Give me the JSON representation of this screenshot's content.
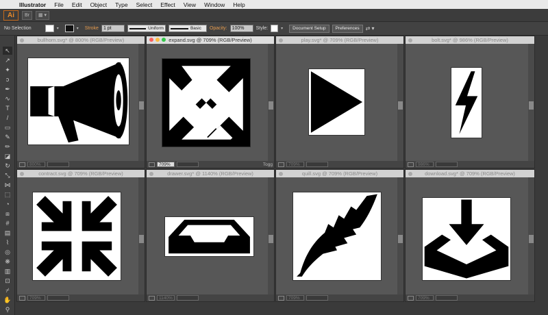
{
  "menubar": {
    "app_name": "Illustrator",
    "items": [
      "File",
      "Edit",
      "Object",
      "Type",
      "Select",
      "Effect",
      "View",
      "Window",
      "Help"
    ]
  },
  "appbar": {
    "logo_text": "Ai",
    "bridge_label": "Br"
  },
  "controlbar": {
    "selection_label": "No Selection",
    "stroke_label": "Stroke",
    "stroke_value": "1 pt",
    "profile_label": "Uniform",
    "brush_label": "Basic",
    "opacity_label": "Opacity:",
    "opacity_value": "100%",
    "style_label": "Style:",
    "document_setup_label": "Document Setup",
    "preferences_label": "Preferences"
  },
  "windows": [
    {
      "title": "bullhorn.svg* @ 800% (RGB/Preview)",
      "zoom": "800%",
      "icon": "bullhorn-icon",
      "active": false
    },
    {
      "title": "expand.svg @ 709% (RGB/Preview)",
      "zoom": "709%",
      "icon": "expand-icon",
      "active": true
    },
    {
      "title": "play.svg* @ 709% (RGB/Preview)",
      "zoom": "709%",
      "icon": "play-icon",
      "active": false
    },
    {
      "title": "bolt.svg* @ 986% (RGB/Preview)",
      "zoom": "986%",
      "icon": "bolt-icon",
      "active": false
    },
    {
      "title": "contract.svg @ 709% (RGB/Preview)",
      "zoom": "709%",
      "icon": "contract-icon",
      "active": false
    },
    {
      "title": "drawer.svg* @ 1140% (RGB/Preview)",
      "zoom": "1140%",
      "icon": "drawer-icon",
      "active": false
    },
    {
      "title": "quill.svg @ 709% (RGB/Preview)",
      "zoom": "709%",
      "icon": "quill-icon",
      "active": false
    },
    {
      "title": "download.svg* @ 709% (RGB/Preview)",
      "zoom": "709%",
      "icon": "download-icon",
      "active": false
    }
  ],
  "status_toggle_label": "Togg",
  "colors": {
    "accent": "#e98a2a",
    "traffic_red": "#fc605c",
    "traffic_yellow": "#fdbc40",
    "traffic_green": "#34c84a"
  }
}
